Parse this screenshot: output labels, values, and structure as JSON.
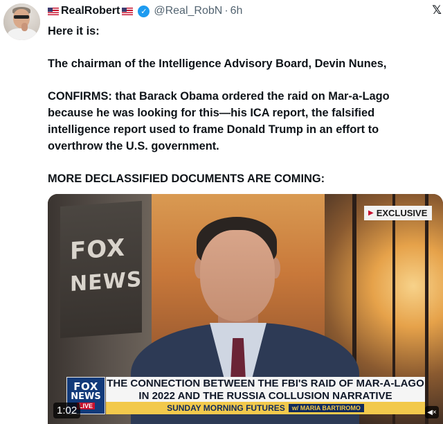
{
  "author": {
    "display_name": "RealRobert",
    "handle": "@Real_RobN",
    "separator": "·",
    "time": "6h",
    "verified_mark": "✓",
    "flag_icon": "us-flag-icon"
  },
  "tweet": {
    "paragraphs": [
      "Here it is:",
      "The chairman of the Intelligence Advisory Board, Devin Nunes,",
      "CONFIRMS: that Barack Obama ordered the raid on Mar-a-Lago because he was looking for this—his ICA report, the falsified intelligence report used to frame Donald Trump in an effort to overthrow the U.S. government.",
      "MORE DECLASSIFIED DOCUMENTS ARE COMING:"
    ]
  },
  "video": {
    "badge": "EXCLUSIVE",
    "badge_icon": "play-triangle-icon",
    "background_sign_line1": "FOX",
    "background_sign_line2": "NEWS",
    "logo_line1": "FOX",
    "logo_line2": "NEWS",
    "logo_live": "LIVE",
    "chyron_line1": "THE CONNECTION BETWEEN THE FBI'S RAID OF MAR-A-LAGO",
    "chyron_line2": "IN 2022 AND THE RUSSIA COLLUSION NARRATIVE",
    "show_name": "SUNDAY MORNING FUTURES",
    "show_host": "w/ MARIA BARTIROMO",
    "duration": "1:02",
    "mute_icon": "speaker-muted-icon"
  },
  "colors": {
    "verified": "#1d9bf0",
    "text": "#0f1419",
    "muted_text": "#536471",
    "chyron_yellow": "#f2c94c",
    "fox_blue": "#123a7a"
  }
}
